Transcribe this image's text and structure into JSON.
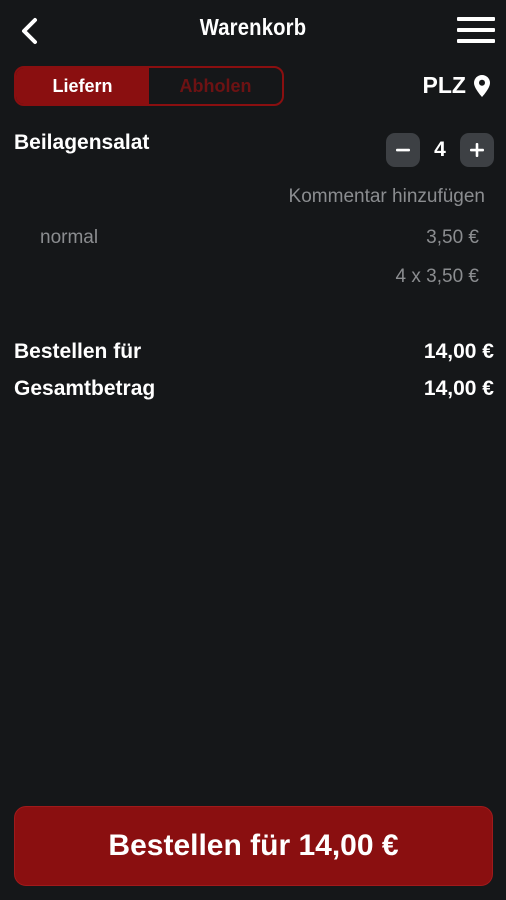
{
  "header": {
    "title": "Warenkorb",
    "back_icon": "chevron-left-icon",
    "menu_icon": "hamburger-menu-icon"
  },
  "delivery_toggle": {
    "options": [
      "Liefern",
      "Abholen"
    ],
    "selected": "Liefern"
  },
  "location": {
    "label": "PLZ",
    "icon": "map-pin-icon"
  },
  "cart": {
    "items": [
      {
        "name": "Beilagensalat",
        "quantity": "4",
        "comment_link": "Kommentar hinzufügen",
        "option": "normal",
        "unit_price": "3,50 €",
        "line_total": "4 x 3,50 €"
      }
    ]
  },
  "summary": {
    "order_for_label": "Bestellen für",
    "order_for_value": "14,00 €",
    "total_label": "Gesamtbetrag",
    "total_value": "14,00 €"
  },
  "footer": {
    "order_button_label": "Bestellen für 14,00 €"
  },
  "colors": {
    "background": "#151719",
    "accent": "#8a0f10",
    "muted_text": "#8b8d90",
    "stepper_bg": "#3d4044"
  }
}
